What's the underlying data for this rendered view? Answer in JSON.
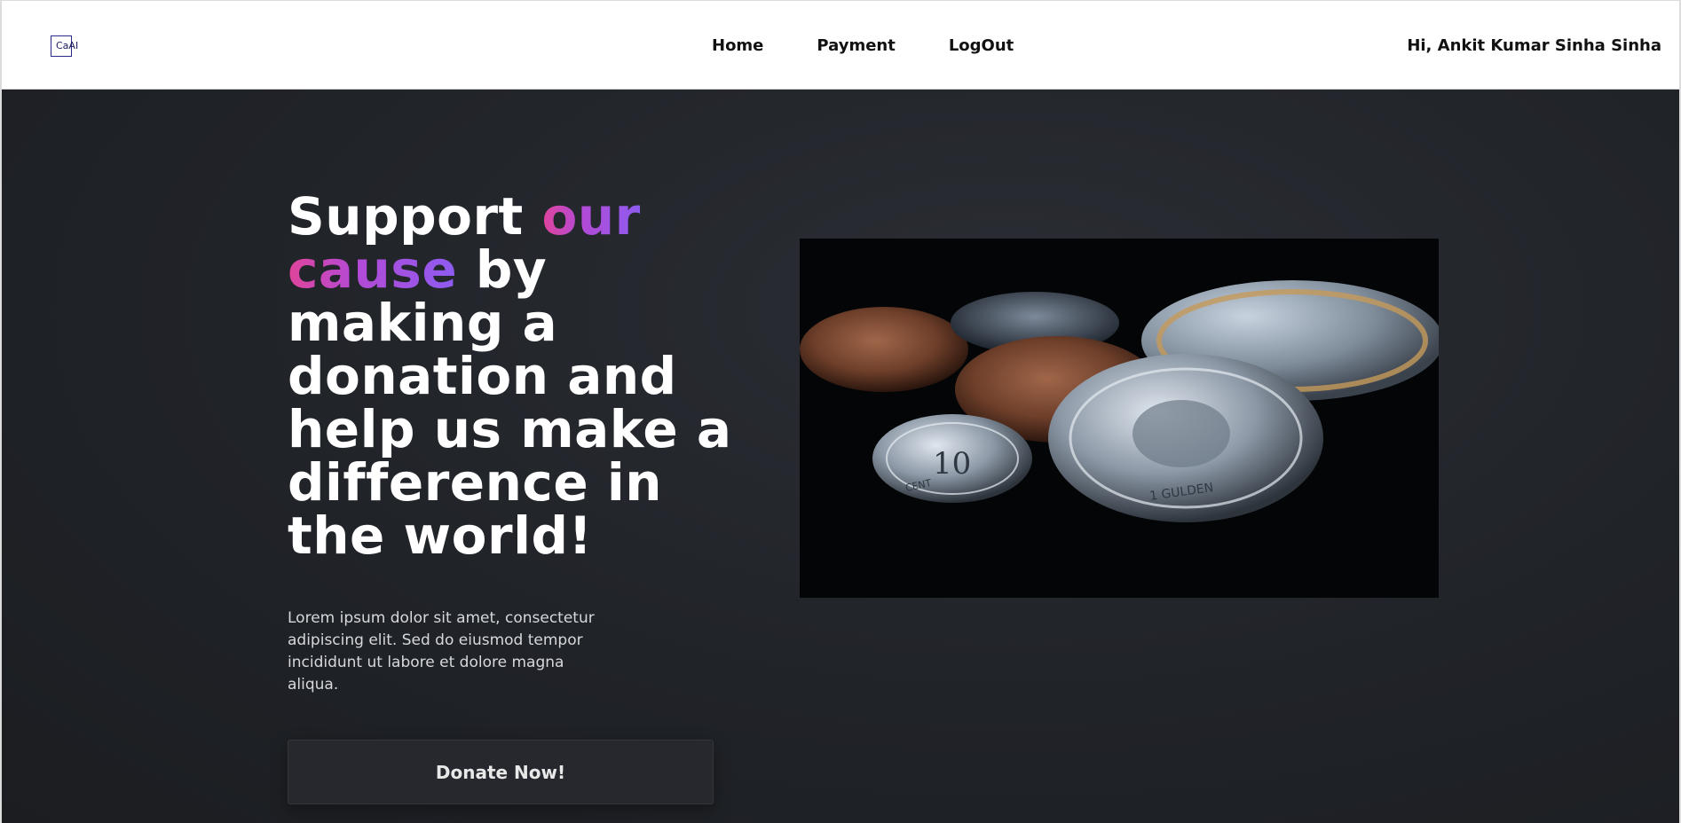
{
  "navbar": {
    "logo_text": "CaAI",
    "links": [
      "Home",
      "Payment",
      "LogOut"
    ],
    "greeting": "Hi, Ankit Kumar Sinha Sinha"
  },
  "hero": {
    "headline": {
      "part1": "Support ",
      "highlight1": "our",
      "highlight2": "cause",
      "part2": " by making a donation and help us make a difference in the world!"
    },
    "description": "Lorem ipsum dolor sit amet, consectetur adipiscing elit. Sed do eiusmod tempor incididunt ut labore et dolore magna aliqua.",
    "donate_label": "Donate Now!",
    "image_icon": "coins-photo",
    "coin_labels": [
      "CENT",
      "1 GULDEN"
    ]
  },
  "colors": {
    "hero_bg": "#202328",
    "highlight_start": "#e0449a",
    "highlight_end": "#8d5cf0",
    "button_bg": "#26282e"
  }
}
